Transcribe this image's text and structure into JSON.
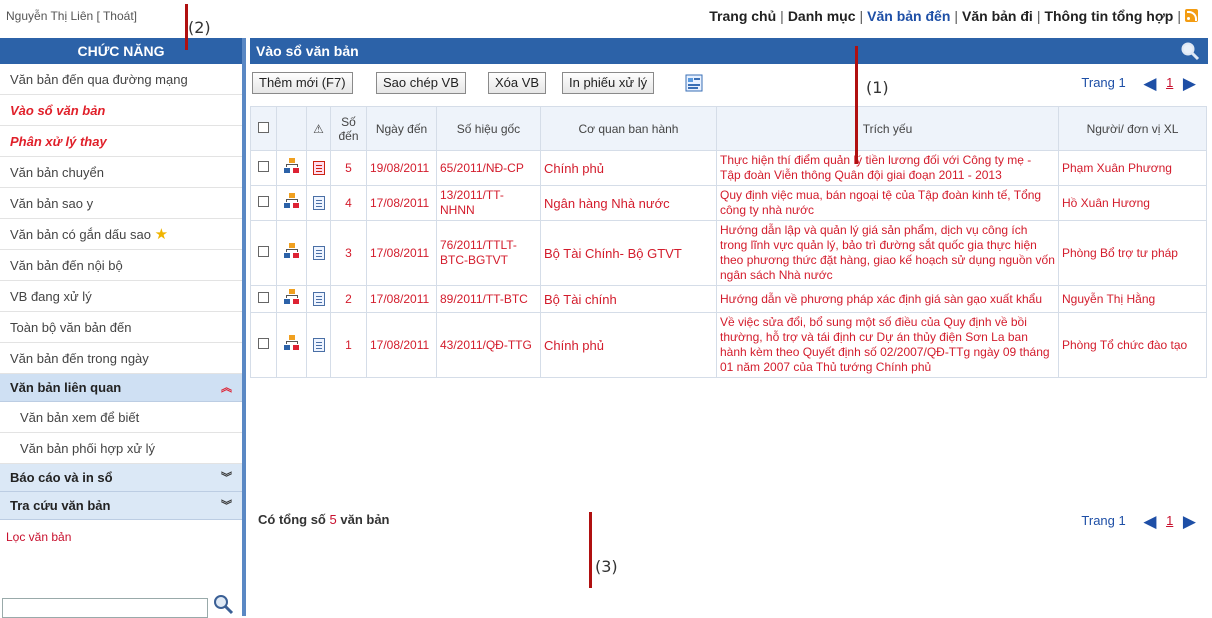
{
  "user": {
    "name": "Nguyễn Thị Liên",
    "logout": "[ Thoát]"
  },
  "nav": {
    "items": [
      "Trang chủ",
      "Danh mục",
      "Văn bản đến",
      "Văn bản đi",
      "Thông tin tổng hợp"
    ],
    "active": "Văn bản đến",
    "rss_icon": "rss-icon"
  },
  "sidebar": {
    "header": "CHỨC NĂNG",
    "items": [
      "Văn bản đến qua đường mạng",
      "Vào sổ văn bản",
      "Phân xử lý thay",
      "Văn bản chuyển",
      "Văn bản sao y",
      "Văn bản có gắn dấu sao",
      "Văn bản đến nội bộ",
      "VB đang xử lý",
      "Toàn bộ văn bản đến",
      "Văn bản đến trong ngày"
    ],
    "highlighted_items": [
      "Vào sổ văn bản",
      "Phân xử lý thay"
    ],
    "group_related": "Văn bản liên quan",
    "related_items": [
      "Văn bản xem để biết",
      "Văn bản phối hợp xử lý"
    ],
    "group_report": "Báo cáo và in sổ",
    "group_search": "Tra cứu văn bản",
    "filter_label": "Lọc văn bản",
    "filter_value": ""
  },
  "main": {
    "title": "Vào sổ văn bản",
    "buttons": [
      "Thêm mới (F7)",
      "Sao chép VB",
      "Xóa VB",
      "In phiếu xử lý"
    ],
    "pager": {
      "label": "Trang 1",
      "current": "1"
    },
    "columns": [
      "Số đến",
      "Ngày đến",
      "Số hiệu gốc",
      "Cơ quan ban hành",
      "Trích yếu",
      "Người/ đơn vị XL"
    ],
    "rows": [
      {
        "so_den": "5",
        "file": "pdf",
        "ngay_den": "19/08/2011",
        "so_hieu": "65/2011/NĐ-CP",
        "co_quan": "Chính phủ",
        "trich_yeu": "Thực hiện thí điểm quản lý tiền lương đối với Công ty mẹ - Tập đoàn Viễn thông Quân đội giai đoạn 2011 - 2013",
        "nguoi_xl": "Phạm Xuân Phương"
      },
      {
        "so_den": "4",
        "file": "doc",
        "ngay_den": "17/08/2011",
        "so_hieu": "13/2011/TT-NHNN",
        "co_quan": "Ngân hàng Nhà nước",
        "trich_yeu": "Quy định việc mua, bán ngoại tệ của Tập đoàn kinh tế, Tổng công ty nhà nước",
        "nguoi_xl": "Hồ Xuân Hương"
      },
      {
        "so_den": "3",
        "file": "doc",
        "ngay_den": "17/08/2011",
        "so_hieu": "76/2011/TTLT-BTC-BGTVT",
        "co_quan": "Bộ Tài Chính- Bộ GTVT",
        "trich_yeu": "Hướng dẫn lập và quản lý giá sản phẩm, dịch vụ công ích trong lĩnh vực quản lý, bảo trì đường sắt quốc gia thực hiện theo phương thức đặt hàng, giao kế hoạch sử dụng nguồn vốn ngân sách Nhà nước",
        "nguoi_xl": "Phòng Bổ trợ tư pháp"
      },
      {
        "so_den": "2",
        "file": "doc",
        "ngay_den": "17/08/2011",
        "so_hieu": "89/2011/TT-BTC",
        "co_quan": "Bộ Tài chính",
        "trich_yeu": "Hướng dẫn về phương pháp xác định giá sàn gạo xuất khẩu",
        "nguoi_xl": "Nguyễn Thị Hằng"
      },
      {
        "so_den": "1",
        "file": "doc",
        "ngay_den": "17/08/2011",
        "so_hieu": "43/2011/QĐ-TTG",
        "co_quan": "Chính phủ",
        "trich_yeu": "Về việc sửa đổi, bổ sung một số điều của Quy định về bồi thường, hỗ trợ và tái định cư Dự án thủy điện Sơn La ban hành kèm theo Quyết định số 02/2007/QĐ-TTg ngày 09 tháng 01 năm 2007 của Thủ tướng Chính phủ",
        "nguoi_xl": "Phòng Tổ chức đào tạo"
      }
    ],
    "total": {
      "prefix": "Có tổng số",
      "count": "5",
      "suffix": "văn bản"
    }
  },
  "annotations": [
    "(1)",
    "(2)",
    "(3)"
  ],
  "colors": {
    "header_blue": "#2c62a8",
    "link_red": "#d31c2c",
    "group_bg": "#cfe0f3"
  }
}
